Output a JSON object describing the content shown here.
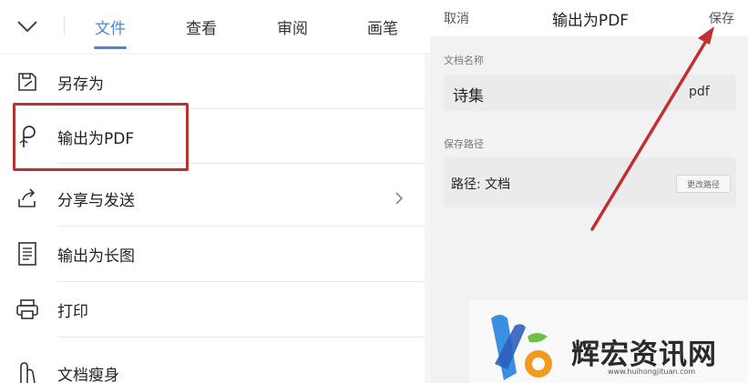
{
  "toolbar": {
    "tabs": [
      {
        "label": "文件",
        "active": true
      },
      {
        "label": "查看",
        "active": false
      },
      {
        "label": "审阅",
        "active": false
      },
      {
        "label": "画笔",
        "active": false
      }
    ],
    "collapse_icon": "chevron-down-icon"
  },
  "menu": {
    "items": [
      {
        "label": "另存为",
        "icon": "save-as-icon"
      },
      {
        "label": "输出为PDF",
        "icon": "pdf-icon"
      },
      {
        "label": "分享与发送",
        "icon": "share-icon"
      },
      {
        "label": "输出为长图",
        "icon": "long-image-icon"
      },
      {
        "label": "打印",
        "icon": "printer-icon"
      },
      {
        "label": "文档瘦身",
        "icon": "slim-document-icon"
      }
    ]
  },
  "dialog": {
    "cancel_label": "取消",
    "title": "输出为PDF",
    "save_label": "保存",
    "name_section_label": "文档名称",
    "file_name": "诗集",
    "extension": "pdf",
    "path_section_label": "保存路径",
    "path_value": "路径: 文档",
    "change_path_label": "更改路径"
  },
  "watermark": {
    "text": "辉宏资讯网",
    "url": "www.huihongjituan.com"
  },
  "colors": {
    "accent": "#4a86d8",
    "highlight": "#b83232"
  }
}
